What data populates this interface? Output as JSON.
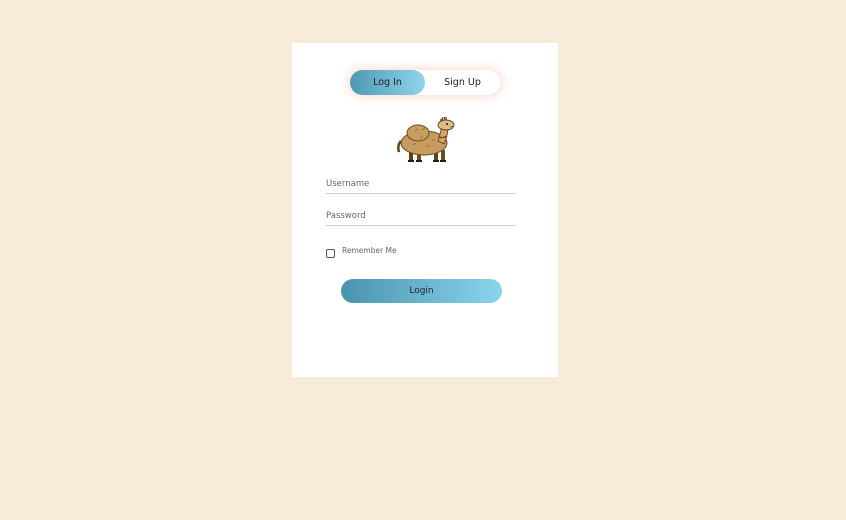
{
  "tabs": {
    "login_label": "Log In",
    "signup_label": "Sign Up",
    "active": "Log In"
  },
  "mascot": {
    "icon": "camel-mascot-icon"
  },
  "form": {
    "username_placeholder": "Username",
    "username_value": "",
    "password_placeholder": "Password",
    "password_value": "",
    "remember_label": "Remember Me",
    "remember_checked": false,
    "submit_label": "Login"
  },
  "colors": {
    "background": "#f8ebd9",
    "card": "#ffffff",
    "accent_start": "#4e98b2",
    "accent_end": "#8ed5ec"
  }
}
